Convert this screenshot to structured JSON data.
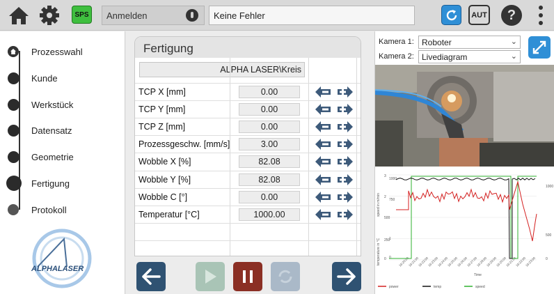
{
  "toolbar": {
    "sps_label": "SPS",
    "login_label": "Anmelden",
    "status_text": "Keine Fehler",
    "aut_label": "AUT",
    "help_label": "?",
    "icons": [
      "home-icon",
      "gear-icon",
      "key-icon",
      "refresh-icon",
      "more-vertical-icon"
    ],
    "accent_color": "#2f8fd6",
    "sps_color": "#3fbf3f"
  },
  "sidebar": {
    "steps": [
      {
        "label": "Prozesswahl"
      },
      {
        "label": "Kunde"
      },
      {
        "label": "Werkstück"
      },
      {
        "label": "Datensatz"
      },
      {
        "label": "Geometrie"
      },
      {
        "label": "Fertigung"
      },
      {
        "label": "Protokoll"
      }
    ],
    "active_step": "Fertigung",
    "logo_text": "ALPHALASER"
  },
  "panel": {
    "title": "Fertigung",
    "path": "ALPHA LASER\\Kreis",
    "rows": [
      {
        "label": "TCP X [mm]",
        "value": "0.00"
      },
      {
        "label": "TCP Y [mm]",
        "value": "0.00"
      },
      {
        "label": "TCP Z [mm]",
        "value": "0.00"
      },
      {
        "label": "Prozessgeschw. [mm/s]",
        "value": "3.00"
      },
      {
        "label": "Wobble X [%]",
        "value": "82.08"
      },
      {
        "label": "Wobble Y [%]",
        "value": "82.08"
      },
      {
        "label": "Wobble C [°]",
        "value": "0.00"
      },
      {
        "label": "Temperatur [°C]",
        "value": "1000.00"
      }
    ]
  },
  "actions": {
    "icons": [
      "arrow-left-icon",
      "play-icon",
      "pause-icon",
      "refresh-icon",
      "arrow-right-icon"
    ],
    "colors": {
      "nav": "#2f5272",
      "play": "#a9c4b6",
      "pause": "#8b2f24",
      "reload": "#aab9c8"
    }
  },
  "camera": {
    "cam1_label": "Kamera 1:",
    "cam1_value": "Roboter",
    "cam2_label": "Kamera 2:",
    "cam2_value": "Livediagram"
  },
  "live_chart": {
    "ylabel_left": "speed in m/min",
    "ylabel_left2": "temperature in °C",
    "left_ticks": [
      "3",
      "1000",
      "2",
      "750",
      "500",
      "1",
      "250",
      "0",
      "0"
    ],
    "right_ticks": [
      "1000",
      "500",
      "0"
    ],
    "xlabel": "Time",
    "legend": [
      "power",
      "temp",
      "speed"
    ],
    "colors": {
      "power": "#d42020",
      "temp": "#111111",
      "speed": "#2fb02f"
    }
  }
}
